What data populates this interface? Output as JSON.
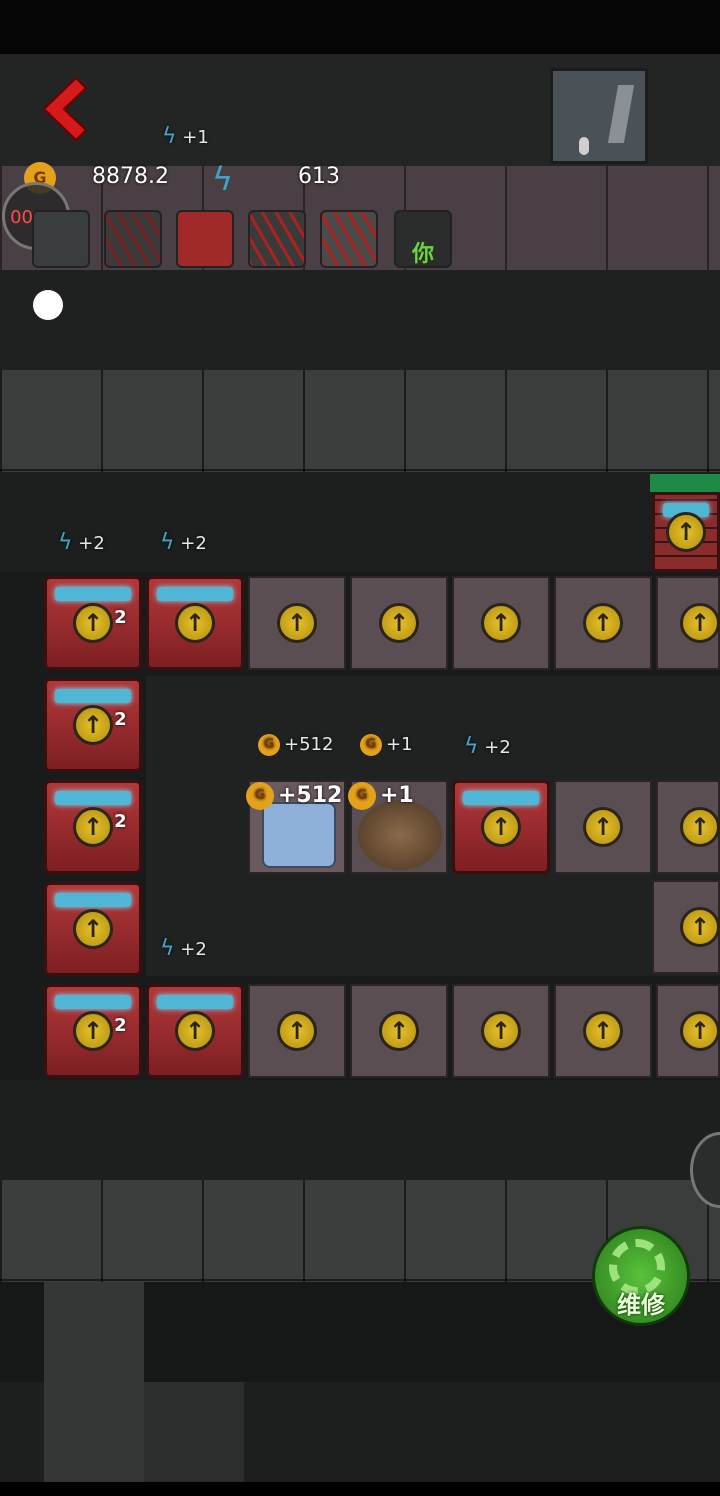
{
  "hud": {
    "gold_value": "8878.2",
    "energy_value": "613",
    "energy_top_gain": "+1",
    "timer": "00:00",
    "coin_letter": "G"
  },
  "labels": {
    "energy_plus_two": "+2",
    "energy_plus_one": "+1",
    "gold_plus_512": "+512",
    "gold_plus_one": "+1",
    "level_two": "2",
    "avatar_you": "你"
  },
  "repair_button": {
    "label": "维修"
  },
  "colors": {
    "accent_gold": "#e4a11b",
    "energy_blue": "#3fa6c9",
    "repair_green": "#3b9a2a",
    "back_red": "#d41a1a"
  }
}
